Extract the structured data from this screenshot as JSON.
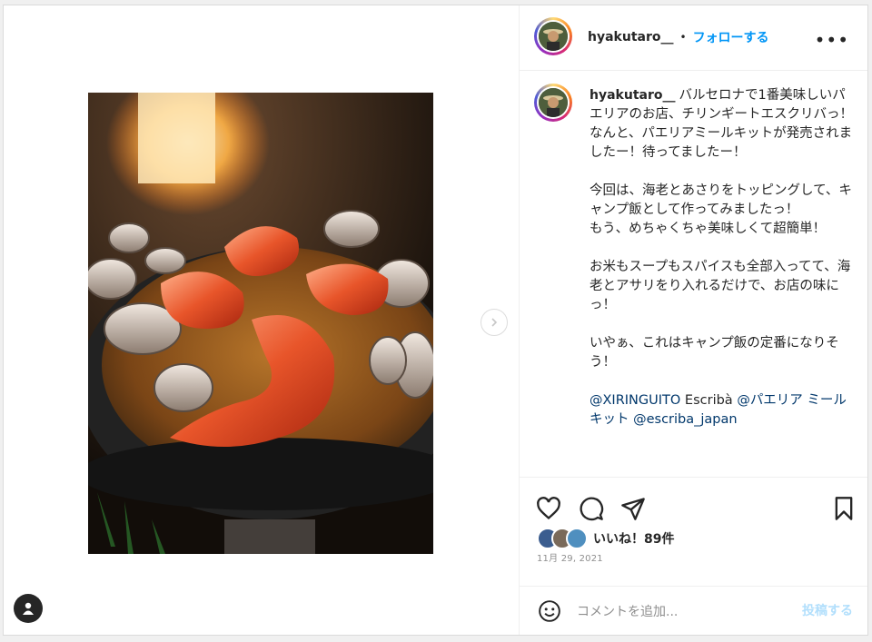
{
  "post": {
    "username": "hyakutaro__",
    "separator": "•",
    "follow_label": "フォローする",
    "more_label": "•••",
    "caption_text": "バルセロナで1番美味しいパエリアのお店、チリンギートエスクリバっ！\nなんと、パエリアミールキットが発売されましたー！待ってましたー！\n\n今回は、海老とあさりをトッピングして、キャンプ飯として作ってみましたっ！\nもう、めちゃくちゃ美味しくて超簡単！\n\nお米もスープもスパイスも全部入ってて、海老とアサリをり入れるだけで、お店の味にっ！\n\nいやぁ、これはキャンプ飯の定番になりそう！\n\n",
    "mention_1": "@XIRINGUITO",
    "caption_mid": " Escribà ",
    "mention_2": "@パエリア ミールキット",
    "mention_3": " @escriba_japan",
    "likes": "いいね！89件",
    "date": "11月 29, 2021",
    "comment_placeholder": "コメントを追加...",
    "post_label": "投稿する"
  },
  "icons": {
    "like": "heart-icon",
    "comment": "comment-icon",
    "share": "paper-plane-icon",
    "save": "bookmark-icon",
    "emoji": "emoji-icon",
    "next": "chevron-right-icon",
    "user": "user-icon"
  },
  "colors": {
    "accent": "#0095f6",
    "mention": "#00376b",
    "muted": "#8e8e8e",
    "post_disabled": "#b2dffc"
  }
}
